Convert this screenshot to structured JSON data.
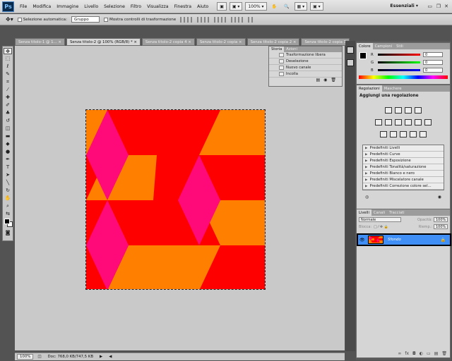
{
  "app": {
    "logo": "Ps",
    "workspace": "Essenziali ▾"
  },
  "menu": [
    "File",
    "Modifica",
    "Immagine",
    "Livello",
    "Selezione",
    "Filtro",
    "Visualizza",
    "Finestra",
    "Aiuto"
  ],
  "menubar_controls": {
    "zoom": "100% ▾"
  },
  "options": {
    "auto_select_label": "Selezione automatica:",
    "auto_select_value": "Gruppo",
    "transform_label": "Mostra controlli di trasformazione"
  },
  "tabs": [
    "Senza titolo-1 @ 1...",
    "Senza titolo-2 @ 100% (RGB/8) *",
    "Senza titolo-2 copia 4",
    "Senza titolo-2 copia",
    "Senza titolo-2 copia 2",
    "Senza titolo-2 copia 3"
  ],
  "tab_close": "×",
  "history": {
    "tabs": [
      "Storia",
      "Azioni"
    ],
    "items": [
      "Trasformazione libera",
      "Deselezione",
      "Nuovo canale",
      "Incolla"
    ]
  },
  "color_panel": {
    "tabs": [
      "Colore",
      "Campioni",
      "Stili"
    ],
    "channels": [
      {
        "label": "R",
        "value": "0",
        "color": "#ff0000"
      },
      {
        "label": "G",
        "value": "0",
        "color": "#00ff00"
      },
      {
        "label": "B",
        "value": "0",
        "color": "#0000ff"
      }
    ]
  },
  "adjustments": {
    "tabs": [
      "Regolazioni",
      "Maschere"
    ],
    "title": "Aggiungi una regolazione",
    "presets": [
      "Predefiniti Livelli",
      "Predefiniti Curve",
      "Predefiniti Esposizione",
      "Predefiniti Tonalità/saturazione",
      "Predefiniti Bianco e nero",
      "Predefiniti Miscelatore canale",
      "Predefiniti Correzione colore sel..."
    ]
  },
  "layers": {
    "tabs": [
      "Livelli",
      "Canali",
      "Tracciati"
    ],
    "blend_mode": "Normale",
    "opacity_label": "Opacità:",
    "opacity": "100%",
    "lock_label": "Blocca:",
    "fill_label": "Riemp.:",
    "fill": "100%",
    "layer_name": "Sfondo"
  },
  "status": {
    "zoom": "100%",
    "doc": "Doc: 768,0 KB/747,5 KB"
  },
  "colors": {
    "orange": "#ff8000",
    "red": "#ff0000",
    "pink": "#ff007f",
    "selected_layer": "#3f8ff7"
  }
}
